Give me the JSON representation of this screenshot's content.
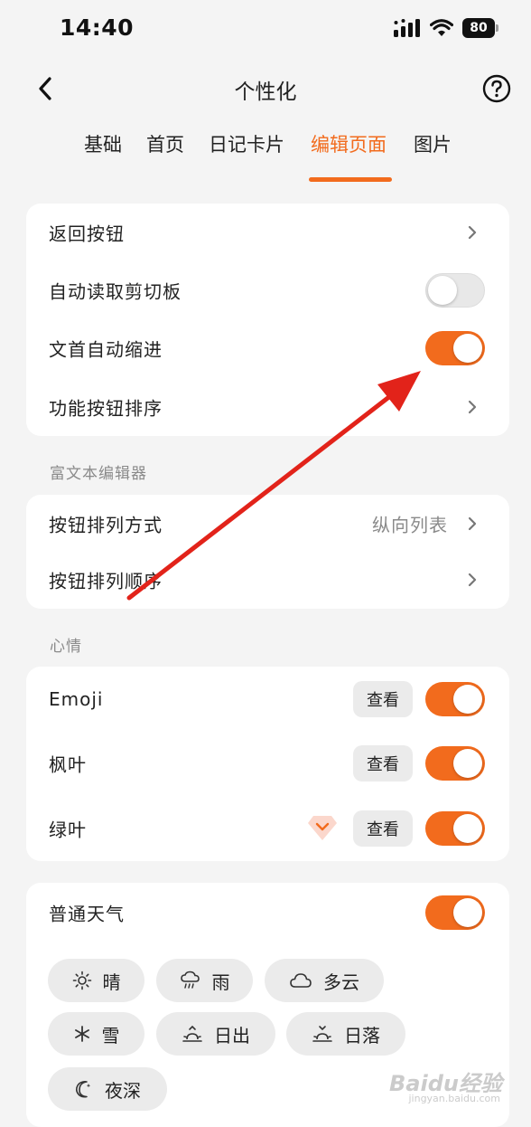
{
  "status_bar": {
    "time": "14:40",
    "battery": "80"
  },
  "nav": {
    "title": "个性化"
  },
  "tabs": [
    {
      "label": "基础"
    },
    {
      "label": "首页"
    },
    {
      "label": "日记卡片"
    },
    {
      "label": "编辑页面",
      "active": true
    },
    {
      "label": "图片"
    }
  ],
  "general": {
    "back_button": "返回按钮",
    "auto_read_clipboard": {
      "label": "自动读取剪切板",
      "on": false
    },
    "auto_indent": {
      "label": "文首自动缩进",
      "on": true
    },
    "function_button_order": "功能按钮排序"
  },
  "rich_text": {
    "section_title": "富文本编辑器",
    "layout_mode": {
      "label": "按钮排列方式",
      "value": "纵向列表"
    },
    "button_order": "按钮排列顺序"
  },
  "mood": {
    "section_title": "心情",
    "view_label": "查看",
    "items": [
      {
        "label": "Emoji",
        "on": true
      },
      {
        "label": "枫叶",
        "on": true
      },
      {
        "label": "绿叶",
        "on": true,
        "premium": true
      }
    ]
  },
  "weather": {
    "label": "普通天气",
    "on": true,
    "chips": [
      {
        "label": "晴",
        "icon": "sun-icon"
      },
      {
        "label": "雨",
        "icon": "rain-icon"
      },
      {
        "label": "多云",
        "icon": "cloud-icon"
      },
      {
        "label": "雪",
        "icon": "snowflake-icon"
      },
      {
        "label": "日出",
        "icon": "sunrise-icon"
      },
      {
        "label": "日落",
        "icon": "sunset-icon"
      },
      {
        "label": "夜深",
        "icon": "moon-icon"
      }
    ]
  },
  "watermark": {
    "brand": "Baidu经验",
    "url": "jingyan.baidu.com"
  },
  "colors": {
    "accent": "#f26b1d",
    "annotation_arrow": "#e2231a",
    "background": "#f4f4f4"
  }
}
